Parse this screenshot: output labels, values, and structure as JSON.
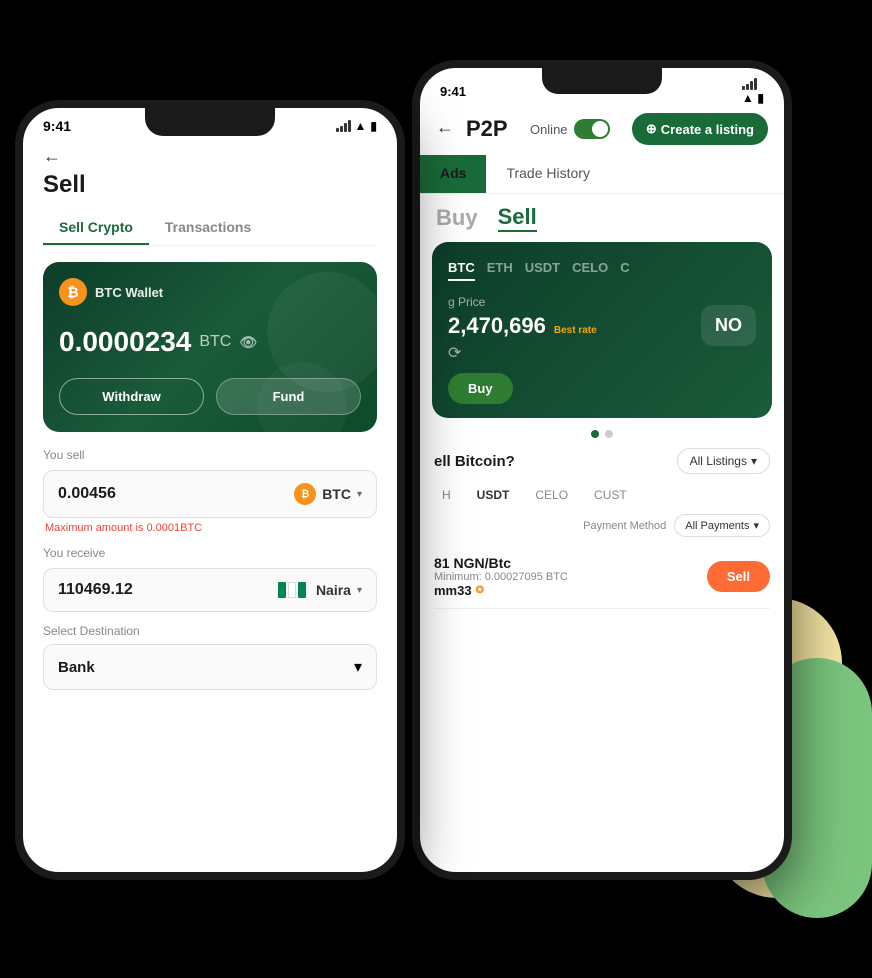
{
  "colors": {
    "primary_green": "#1a6b3a",
    "btc_orange": "#f7931a",
    "dark_green_bg": "#0d3d2a",
    "sell_orange": "#ff6b35"
  },
  "front_phone": {
    "status_bar": {
      "time": "9:41",
      "signal": "signal",
      "wifi": "wifi",
      "battery": "battery"
    },
    "back_arrow": "←",
    "title": "Sell",
    "tabs": [
      {
        "label": "Sell Crypto",
        "active": true
      },
      {
        "label": "Transactions",
        "active": false
      }
    ],
    "wallet_card": {
      "wallet_name": "BTC Wallet",
      "balance": "0.0000234",
      "currency": "BTC",
      "withdraw_label": "Withdraw",
      "fund_label": "Fund"
    },
    "you_sell": {
      "label": "You sell",
      "value": "0.00456",
      "currency": "BTC"
    },
    "error_text": "Maximum amount is 0.0001BTC",
    "you_receive": {
      "label": "You receive",
      "value": "110469.12",
      "currency": "Naira"
    },
    "select_destination": {
      "label": "Select Destination",
      "value": "Bank"
    }
  },
  "back_phone": {
    "status_bar": {
      "time": "9:41"
    },
    "back_arrow": "←",
    "p2p_title": "P2P",
    "online_label": "Online",
    "create_listing_label": "Create a listing",
    "tabs": [
      {
        "label": "Ads",
        "active": true
      },
      {
        "label": "Trade History",
        "active": false
      }
    ],
    "buy_sell": {
      "buy": "Buy",
      "sell": "Sell",
      "active": "sell"
    },
    "crypto_card": {
      "tabs": [
        "BTC",
        "ETH",
        "USDT",
        "CELO",
        "C"
      ],
      "active_tab": "BTC",
      "listing_price_label": "g Price",
      "listing_price": "2,470,696",
      "best_rate_label": "Best rate",
      "no_listing": "NO",
      "buy_btn": "Buy"
    },
    "carousel_dots": [
      {
        "active": true
      },
      {
        "active": false
      }
    ],
    "sell_bitcoin_section": {
      "prefix": "ell Bitcoin?",
      "all_listings": "All Listings",
      "filter_tabs": [
        "H",
        "USDT",
        "CELO",
        "CUST"
      ],
      "payment_method_label": "Payment Method",
      "all_payments": "All Payments"
    },
    "listing_row": {
      "price": "81 NGN/Btc",
      "min_label": "Minimum: 0.00027095 BTC",
      "user": "mm33",
      "sell_btn": "Sell"
    }
  }
}
